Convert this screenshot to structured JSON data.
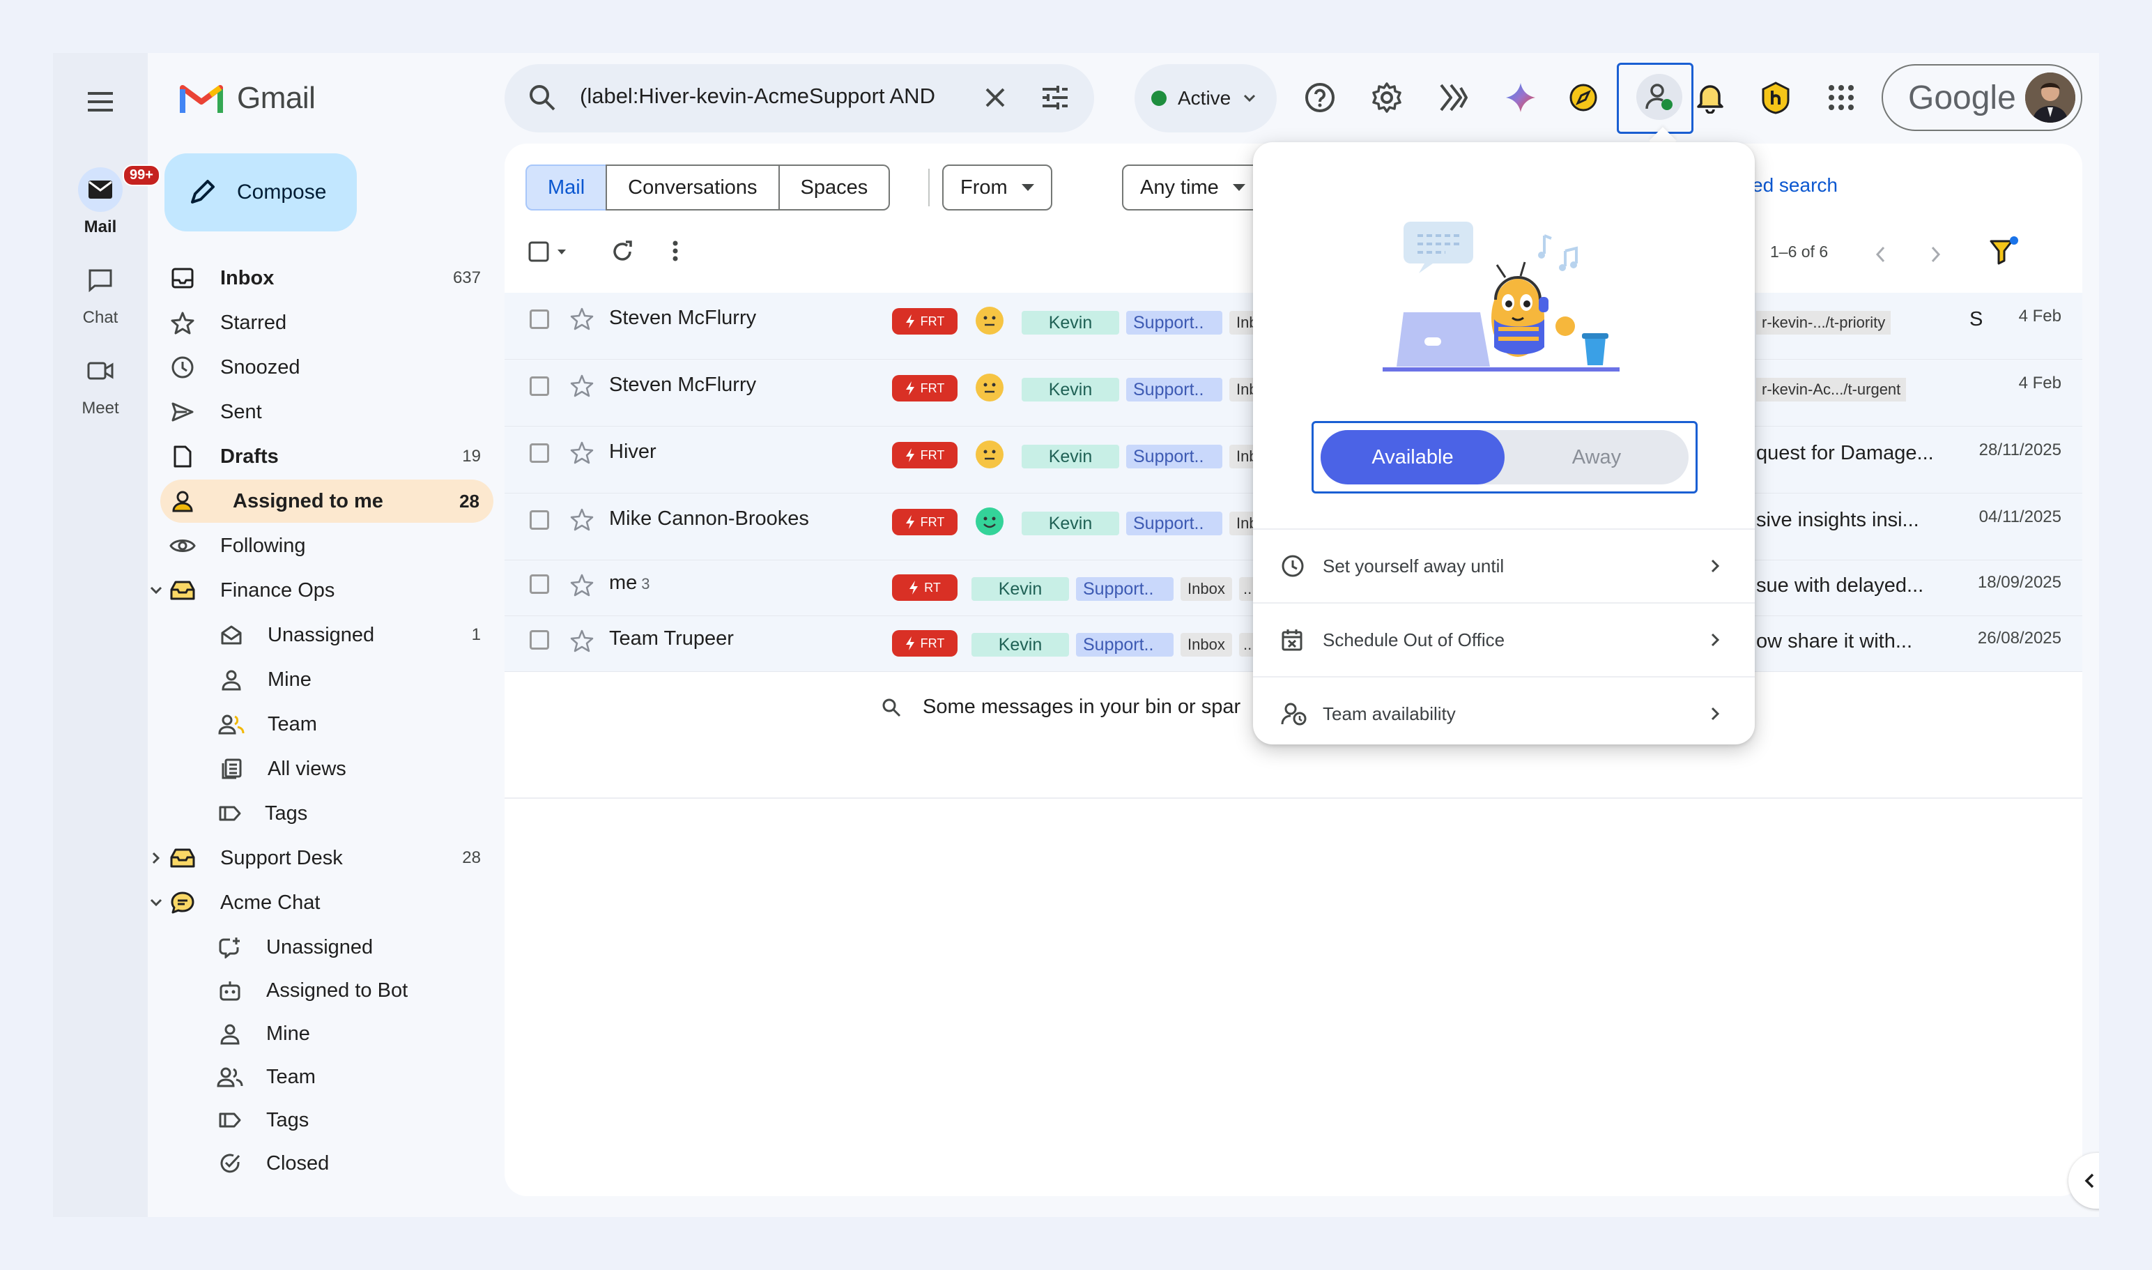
{
  "rail": {
    "mail_label": "Mail",
    "mail_badge": "99+",
    "chat_label": "Chat",
    "meet_label": "Meet"
  },
  "app": {
    "logo_text": "Gmail"
  },
  "compose_label": "Compose",
  "nav": {
    "inbox": {
      "label": "Inbox",
      "count": "637"
    },
    "starred": {
      "label": "Starred"
    },
    "snoozed": {
      "label": "Snoozed"
    },
    "sent": {
      "label": "Sent"
    },
    "drafts": {
      "label": "Drafts",
      "count": "19"
    },
    "assigned": {
      "label": "Assigned to me",
      "count": "28"
    },
    "following": {
      "label": "Following"
    },
    "finance_ops": {
      "label": "Finance Ops"
    },
    "fo_unassigned": {
      "label": "Unassigned",
      "count": "1"
    },
    "fo_mine": {
      "label": "Mine"
    },
    "fo_team": {
      "label": "Team"
    },
    "fo_allviews": {
      "label": "All views"
    },
    "fo_tags": {
      "label": "Tags"
    },
    "support_desk": {
      "label": "Support Desk",
      "count": "28"
    },
    "acme_chat": {
      "label": "Acme Chat"
    },
    "ac_unassigned": {
      "label": "Unassigned"
    },
    "ac_bot": {
      "label": "Assigned to Bot"
    },
    "ac_mine": {
      "label": "Mine"
    },
    "ac_team": {
      "label": "Team"
    },
    "ac_tags": {
      "label": "Tags"
    },
    "ac_closed": {
      "label": "Closed"
    }
  },
  "search": {
    "query": "(label:Hiver-kevin-AcmeSupport AND"
  },
  "status": {
    "label": "Active",
    "color": "#1e8e3e"
  },
  "google_label": "Google",
  "tabs": [
    "Mail",
    "Conversations",
    "Spaces"
  ],
  "filters": {
    "from": "From",
    "any_time": "Any time"
  },
  "advanced_search": "ed search",
  "pager": "1–6 of 6",
  "rows": [
    {
      "sender": "Steven McFlurry",
      "count": "",
      "tag": "FRT",
      "mood": "neutral",
      "assignee": "Kevin",
      "label": "Support..",
      "inbox": "Inbo",
      "snippet": "r-kevin-.../t-priority",
      "snippet2": "S",
      "date": "4 Feb"
    },
    {
      "sender": "Steven McFlurry",
      "count": "",
      "tag": "FRT",
      "mood": "neutral",
      "assignee": "Kevin",
      "label": "Support..",
      "inbox": "Inbo",
      "snippet": "r-kevin-Ac.../t-urgent",
      "snippet2": "",
      "date": "4 Feb"
    },
    {
      "sender": "Hiver",
      "count": "",
      "tag": "FRT",
      "mood": "neutral",
      "assignee": "Kevin",
      "label": "Support..",
      "inbox": "Inbo",
      "snippet": "quest for Damage...",
      "snippet2": "",
      "date": "28/11/2025"
    },
    {
      "sender": "Mike Cannon-Brookes",
      "count": "",
      "tag": "FRT",
      "mood": "happy",
      "assignee": "Kevin",
      "label": "Support..",
      "inbox": "Inbo",
      "snippet": "sive insights insi...",
      "snippet2": "",
      "date": "04/11/2025"
    },
    {
      "sender": "me",
      "count": "3",
      "tag": "RT",
      "mood": "",
      "assignee": "Kevin",
      "label": "Support..",
      "inbox": "Inbox",
      "more": "...",
      "snippet": "sue with delayed...",
      "snippet2": "",
      "date": "18/09/2025"
    },
    {
      "sender": "Team Trupeer",
      "count": "",
      "tag": "FRT",
      "mood": "",
      "assignee": "Kevin",
      "label": "Support..",
      "inbox": "Inbox",
      "more": "...",
      "snippet": "ow share it with...",
      "snippet2": "",
      "date": "26/08/2025"
    }
  ],
  "bin_notice": "Some messages in your bin or spar",
  "popup": {
    "available": "Available",
    "away": "Away",
    "away_until": "Set yourself away until",
    "out_of_office": "Schedule Out of Office",
    "team_availability": "Team availability"
  },
  "colors": {
    "accent": "#0b57d0",
    "toggle": "#4b63e6",
    "frt": "#d93025",
    "selected_nav": "#fce8cf"
  }
}
